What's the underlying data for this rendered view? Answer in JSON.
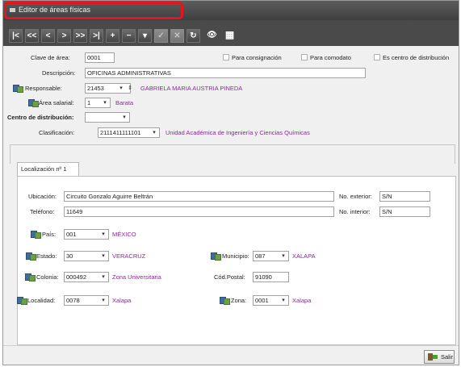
{
  "window": {
    "title": "Editor de áreas físicas"
  },
  "toolbar": {
    "first": "|<",
    "prev_page": "<<",
    "prev": "<",
    "next": ">",
    "next_page": ">>",
    "last": ">|",
    "add": "+",
    "remove": "−",
    "edit": "▾",
    "save": "✓",
    "cancel": "✕",
    "refresh": "↻",
    "binoculars": "👁",
    "grid": "▦"
  },
  "form": {
    "clave_label": "Clave de área:",
    "clave_value": "0001",
    "para_consignacion": "Para consignación",
    "para_comodato": "Para comodato",
    "centro_distribucion_chk": "Es centro de distribución",
    "descripcion_label": "Descripción:",
    "descripcion_value": "OFICINAS ADMINISTRATIVAS",
    "responsable_label": "Responsable:",
    "responsable_value": "21453",
    "responsable_name": "GABRIELA MARIA AUSTRIA PINEDA",
    "area_salarial_label": "Área salarial:",
    "area_salarial_value": "1",
    "area_salarial_name": "Barata",
    "centro_label": "Centro de distribución:",
    "centro_value": "",
    "clasificacion_label": "Clasificación:",
    "clasificacion_value": "2111411111101",
    "clasificacion_name": "Unidad Académica de Ingeniería y Ciencias Químicas"
  },
  "tab": {
    "label": "Localización nº 1"
  },
  "loc": {
    "ubicacion_label": "Ubicación:",
    "ubicacion_value": "Circuito Gonzalo Aguirre Beltrán",
    "no_exterior_label": "No. exterior:",
    "no_exterior_value": "S/N",
    "telefono_label": "Teléfono:",
    "telefono_value": "11649",
    "no_interior_label": "No. interior:",
    "no_interior_value": "S/N",
    "pais_label": "País:",
    "pais_value": "001",
    "pais_name": "MÉXICO",
    "estado_label": "Estado:",
    "estado_value": "30",
    "estado_name": "VERACRUZ",
    "municipio_label": "Municipio:",
    "municipio_value": "087",
    "municipio_name": "XALAPA",
    "colonia_label": "Colonia:",
    "colonia_value": "000492",
    "colonia_name": "Zona Universitaria",
    "cod_postal_label": "Cód.Postal:",
    "cod_postal_value": "91090",
    "localidad_label": "Localidad:",
    "localidad_value": "0078",
    "localidad_name": "Xalapa",
    "zona_label": "Zona:",
    "zona_value": "0001",
    "zona_name": "Xalapa"
  },
  "footer": {
    "salir_label": "Salir"
  },
  "colors": {
    "accent_purple": "#8a2b9a",
    "highlight_red": "#e8141b",
    "toolbar_bg": "#4a4a4a"
  }
}
